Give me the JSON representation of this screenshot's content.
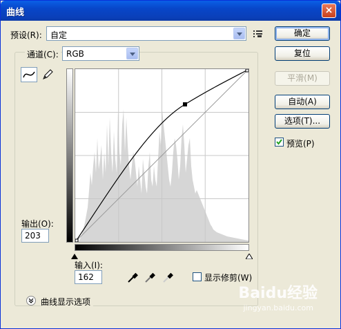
{
  "window": {
    "title": "曲线",
    "close": "×"
  },
  "preset": {
    "label": "预设(R):",
    "value": "自定"
  },
  "channel": {
    "label": "通道(C):",
    "value": "RGB"
  },
  "buttons": {
    "ok": "确定",
    "reset": "复位",
    "smooth": "平滑(M)",
    "auto": "自动(A)",
    "options": "选项(T)..."
  },
  "preview": {
    "label": "预览(P)",
    "checked": true
  },
  "output": {
    "label": "输出(O):",
    "value": "203"
  },
  "input": {
    "label": "输入(I):",
    "value": "162"
  },
  "show_clipping": {
    "label": "显示修剪(W)",
    "checked": false
  },
  "curve_display_options": {
    "label": "曲线显示选项"
  },
  "watermark": {
    "text": "Baidu经验",
    "sub": "jingyan.baidu.com"
  },
  "colors": {
    "titlebar": "#0846c8",
    "dialog_bg": "#ece9d8",
    "histogram": "#d4d4d4"
  }
}
